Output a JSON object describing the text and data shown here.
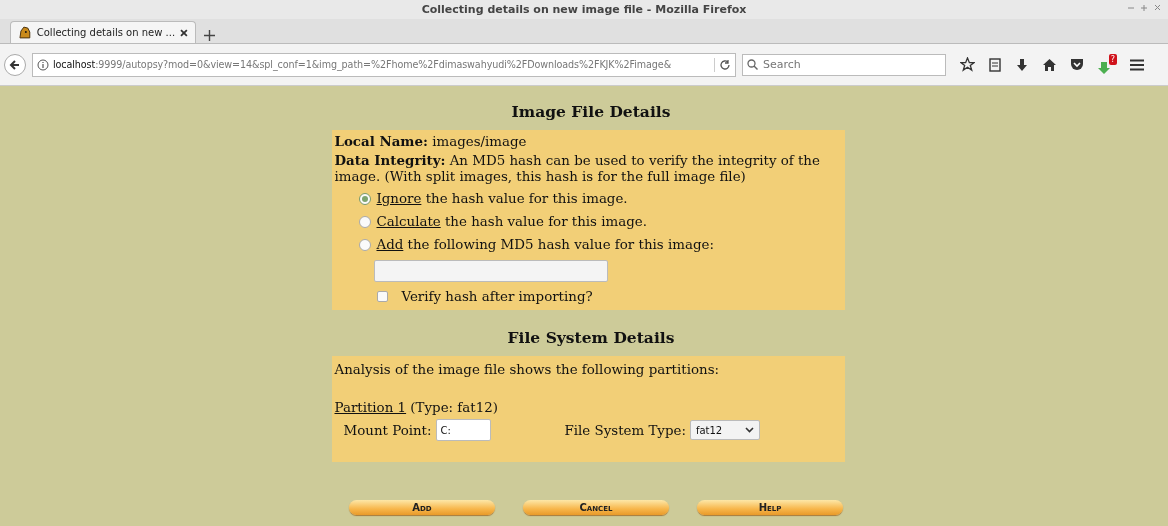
{
  "window": {
    "title": "Collecting details on new image file - Mozilla Firefox"
  },
  "tabs": [
    {
      "label": "Collecting details on new ...",
      "selected": true
    }
  ],
  "address_bar": {
    "host": "localhost",
    "rest": ":9999/autopsy?mod=0&view=14&spl_conf=1&img_path=%2Fhome%2Fdimaswahyudi%2FDownloads%2FKJK%2Fimage&"
  },
  "search": {
    "placeholder": "Search"
  },
  "notification_badge": "?",
  "image_section": {
    "heading": "Image File Details",
    "local_name": "**Local Name:** images/image",
    "integrity": "**Data Integrity:** An MD5 hash can be used to verify the integrity of the image. (With split images, this hash is for the full image file)",
    "options": [
      {
        "link": "Ignore",
        "text": " the hash value for this image.",
        "selected": true
      },
      {
        "link": "Calculate",
        "text": " the hash value for this image.",
        "selected": false
      },
      {
        "link": "Add",
        "text": " the following MD5 hash value for this image:",
        "selected": false
      }
    ],
    "verify": {
      "label": "Verify hash after importing?",
      "checked": false
    }
  },
  "fs_section": {
    "heading": "File System Details",
    "intro": "Analysis of the image file shows the following partitions:",
    "partition_link": "Partition 1",
    "partition_type": "(Type: fat12)",
    "mount_label": "Mount Point:",
    "mount_value": "C:",
    "fs_label": "File System Type:",
    "fs_value": "fat12"
  },
  "buttons": [
    "Add",
    "Cancel",
    "Help"
  ]
}
